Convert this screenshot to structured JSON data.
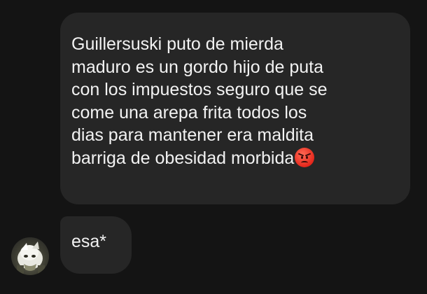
{
  "messages": [
    {
      "sender": "self",
      "text": "Guillersuski puto de mierda\nmaduro es un gordo hijo de puta\ncon los impuestos seguro que se\ncome una arepa frita todos los\ndias para mantener era maldita\nbarriga de obesidad morbida",
      "emoji": "angry-face"
    },
    {
      "sender": "other",
      "text": "esa*"
    }
  ],
  "colors": {
    "background": "#141414",
    "bubble": "#262626",
    "text": "#f2f2f2"
  }
}
